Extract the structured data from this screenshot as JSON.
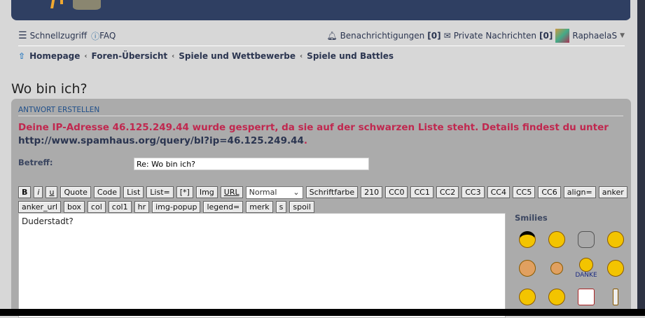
{
  "nav": {
    "quick_access": "Schnellzugriff",
    "faq": "FAQ",
    "notifications": "Benachrichtigungen",
    "notifications_count": "[0]",
    "messages": "Private Nachrichten",
    "messages_count": "[0]",
    "user": "RaphaelaS"
  },
  "breadcrumb": [
    "Homepage",
    "Foren-Übersicht",
    "Spiele und Wettbewerbe",
    "Spiele und Battles"
  ],
  "page_title": "Wo bin ich?",
  "panel": {
    "title": "ANTWORT ERSTELLEN",
    "error": "Deine IP-Adresse 46.125.249.44 wurde gesperrt, da sie auf der schwarzen Liste steht. Details findest du unter ",
    "error_url": "http://www.spamhaus.org/query/bl?ip=46.125.249.44",
    "error_end": ".",
    "subject_label": "Betreff:",
    "subject_value": "Re: Wo bin ich?",
    "message": "Duderstadt?",
    "font_size": "Normal",
    "smilies_title": "Smilies",
    "danke": "DANKE"
  },
  "toolbar_row1": [
    "B",
    "i",
    "u",
    "Quote",
    "Code",
    "List",
    "List=",
    "[*]",
    "Img",
    "URL"
  ],
  "toolbar_row1b": [
    "Schriftfarbe",
    "210",
    "CC0",
    "CC1",
    "CC2",
    "CC3",
    "CC4",
    "CC5",
    "CC6",
    "align=",
    "anker"
  ],
  "toolbar_row2": [
    "anker_url",
    "box",
    "col",
    "col1",
    "hr",
    "img-popup",
    "legend=",
    "merk",
    "s",
    "spoil"
  ]
}
